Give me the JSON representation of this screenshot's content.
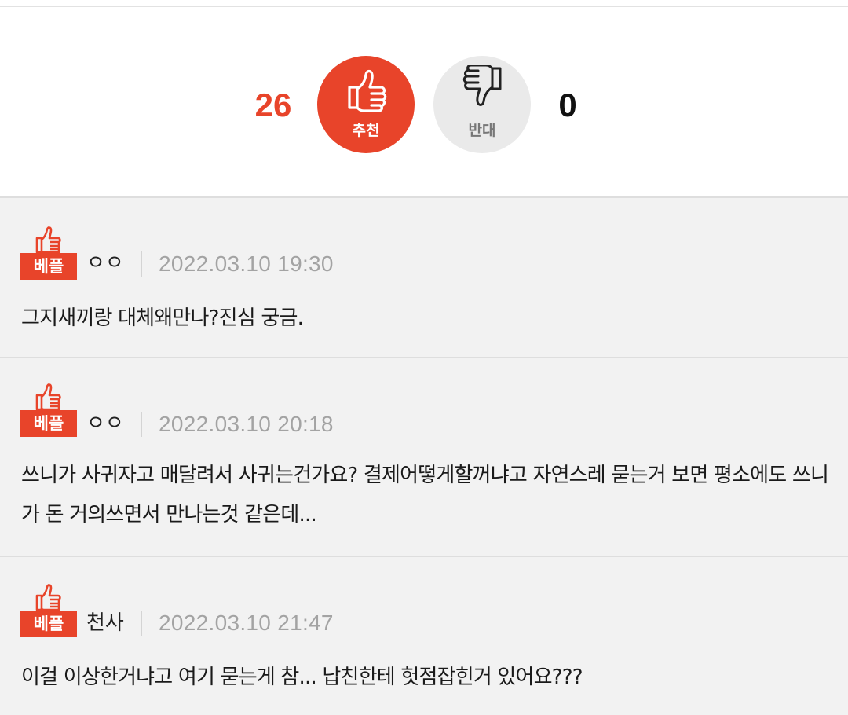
{
  "vote": {
    "up_count": "26",
    "up_label": "추천",
    "down_count": "0",
    "down_label": "반대"
  },
  "comments": [
    {
      "badge": "베플",
      "author": "ㅇㅇ",
      "date": "2022.03.10 19:30",
      "text": "그지새끼랑 대체왜만나?진심 궁금."
    },
    {
      "badge": "베플",
      "author": "ㅇㅇ",
      "date": "2022.03.10 20:18",
      "text": "쓰니가 사귀자고 매달려서 사귀는건가요? 결제어떻게할꺼냐고 자연스레 묻는거 보면 평소에도 쓰니가 돈 거의쓰면서 만나는것 같은데..."
    },
    {
      "badge": "베플",
      "author": "천사",
      "date": "2022.03.10 21:47",
      "text": "이걸 이상한거냐고 여기 묻는게 참... 납친한테 헛점잡힌거 있어요???"
    }
  ],
  "colors": {
    "accent": "#e8442a",
    "comment_bg": "#f2f2f2",
    "date": "#a3a3a3"
  },
  "icons": {
    "up": "thumbs-up-icon",
    "down": "thumbs-down-icon",
    "badge": "best-comment-thumb-icon"
  }
}
